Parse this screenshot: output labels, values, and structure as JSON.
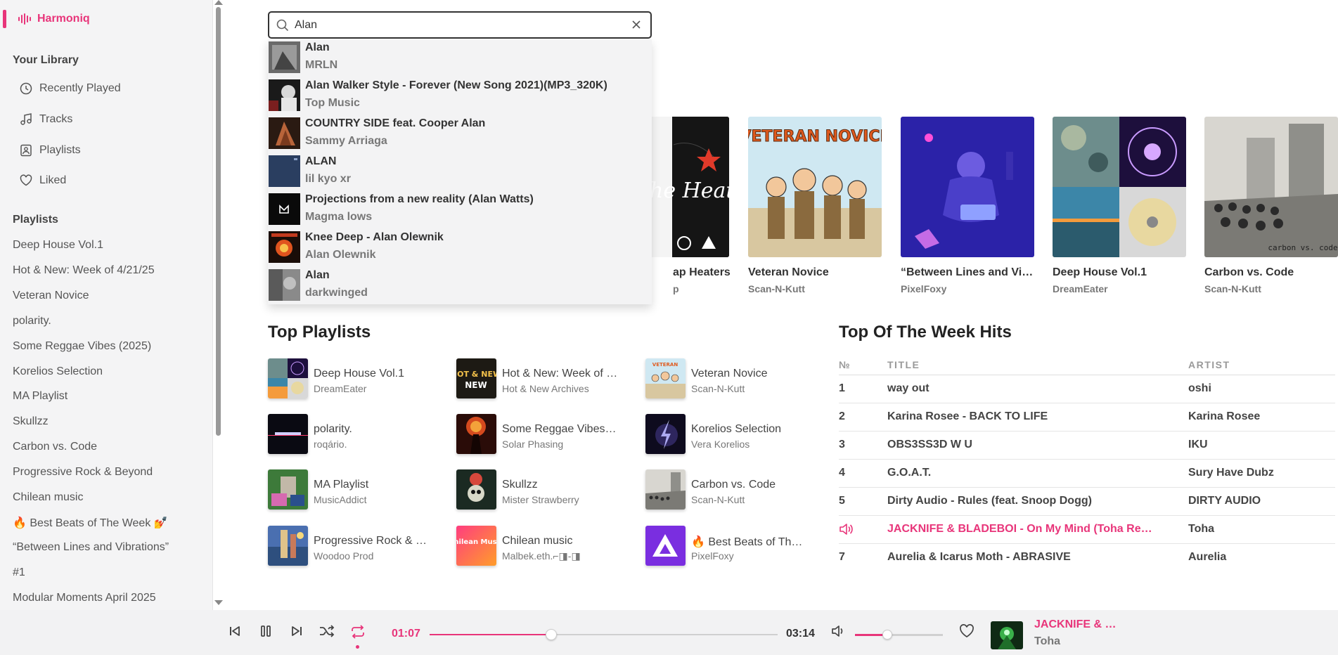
{
  "app": {
    "name": "Harmoniq",
    "accent": "#e8357a"
  },
  "sidebar": {
    "library_title": "Your Library",
    "nav": [
      {
        "label": "Recently Played",
        "icon": "clock-icon"
      },
      {
        "label": "Tracks",
        "icon": "music-note-icon"
      },
      {
        "label": "Playlists",
        "icon": "playlist-icon"
      },
      {
        "label": "Liked",
        "icon": "heart-icon"
      }
    ],
    "playlists_title": "Playlists",
    "playlists": [
      "Deep House Vol.1",
      "Hot & New: Week of 4/21/25",
      "Veteran Novice",
      "polarity.",
      "Some Reggae Vibes (2025)",
      "Korelios Selection",
      "MA Playlist",
      "Skullzz",
      "Carbon vs. Code",
      "Progressive Rock & Beyond",
      "Chilean music",
      "🔥 Best Beats of The Week 💅",
      "“Between Lines and Vibrations”",
      "#1",
      "Modular Moments April 2025"
    ]
  },
  "search": {
    "value": "Alan",
    "results": [
      {
        "title": "Alan",
        "subtitle": "MRLN"
      },
      {
        "title": "Alan Walker Style - Forever (New Song 2021)(MP3_320K)",
        "subtitle": "Top Music"
      },
      {
        "title": "COUNTRY SIDE feat. Cooper Alan",
        "subtitle": "Sammy Arriaga"
      },
      {
        "title": "ALAN",
        "subtitle": "lil kyo xr"
      },
      {
        "title": "Projections from a new reality (Alan Watts)",
        "subtitle": "Magma lows"
      },
      {
        "title": "Knee Deep - Alan Olewnik",
        "subtitle": "Alan Olewnik"
      },
      {
        "title": "Alan",
        "subtitle": "darkwinged"
      }
    ]
  },
  "cards": [
    {
      "title": "ap Heaters",
      "subtitle": "p",
      "art_text": "The Heaters"
    },
    {
      "title": "Veteran Novice",
      "subtitle": "Scan-N-Kutt",
      "art_text": "VETERAN NOVICE"
    },
    {
      "title": "“Between Lines and Vi…",
      "subtitle": "PixelFoxy"
    },
    {
      "title": "Deep House Vol.1",
      "subtitle": "DreamEater"
    },
    {
      "title": "Carbon vs. Code",
      "subtitle": "Scan-N-Kutt",
      "art_text": "carbon vs. code"
    }
  ],
  "top_playlists": {
    "title": "Top Playlists",
    "items": [
      {
        "title": "Deep House Vol.1",
        "subtitle": "DreamEater"
      },
      {
        "title": "Hot & New: Week of …",
        "subtitle": "Hot & New Archives",
        "art_text": "HOT & NEW"
      },
      {
        "title": "Veteran Novice",
        "subtitle": "Scan-N-Kutt"
      },
      {
        "title": "polarity.",
        "subtitle": "roqário."
      },
      {
        "title": "Some Reggae Vibes …",
        "subtitle": "Solar Phasing"
      },
      {
        "title": "Korelios Selection",
        "subtitle": "Vera Korelios"
      },
      {
        "title": "MA Playlist",
        "subtitle": "MusicAddict"
      },
      {
        "title": "Skullzz",
        "subtitle": "Mister Strawberry"
      },
      {
        "title": "Carbon vs. Code",
        "subtitle": "Scan-N-Kutt"
      },
      {
        "title": "Progressive Rock & …",
        "subtitle": "Woodoo Prod"
      },
      {
        "title": "Chilean music",
        "subtitle": "Malbek.eth.⌐◨-◨",
        "art_text": "Chilean Music"
      },
      {
        "title": "🔥 Best Beats of The …",
        "subtitle": "PixelFoxy"
      }
    ]
  },
  "hits": {
    "title": "Top Of The Week Hits",
    "headers": {
      "num": "№",
      "title": "TITLE",
      "artist": "ARTIST"
    },
    "rows": [
      {
        "num": "1",
        "title": "way out",
        "artist": "oshi"
      },
      {
        "num": "2",
        "title": "Karina Rosee - BACK TO LIFE",
        "artist": "Karina Rosee"
      },
      {
        "num": "3",
        "title": "OBS3SS3D W U",
        "artist": "IKU"
      },
      {
        "num": "4",
        "title": "G.O.A.T.",
        "artist": "Sury Have Dubz"
      },
      {
        "num": "5",
        "title": "Dirty Audio - Rules (feat. Snoop Dogg)",
        "artist": "DIRTY AUDIO"
      },
      {
        "num": "",
        "title": "JACKNIFE & BLADEBOI - On My Mind (Toha Re…",
        "artist": "Toha",
        "playing": true
      },
      {
        "num": "7",
        "title": "Aurelia & Icarus Moth - ABRASIVE",
        "artist": "Aurelia"
      }
    ]
  },
  "player": {
    "current_time": "01:07",
    "duration": "03:14",
    "progress": 0.35,
    "volume": 0.37,
    "now_playing_title": "JACKNIFE & …",
    "now_playing_artist": "Toha"
  }
}
